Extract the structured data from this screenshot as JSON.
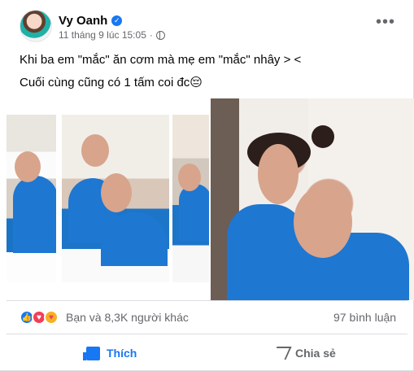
{
  "post": {
    "author": "Vy Oanh",
    "timestamp": "11 tháng 9 lúc 15:05",
    "visibility_icon": "globe-icon",
    "menu_icon": "more-options-icon",
    "text_line_1": "Khi ba em \"mắc\" ăn cơm mà mẹ em \"mắc\" nhây > <",
    "text_line_2": "Cuối cùng cũng có 1 tấm coi đc😔"
  },
  "stats": {
    "reaction_icons": [
      "like-icon",
      "love-icon",
      "care-icon"
    ],
    "reaction_summary": "Bạn và 8,3K người khác",
    "comments": "97 bình luận"
  },
  "actions": {
    "like": "Thích",
    "share": "Chia sẻ"
  },
  "colors": {
    "facebook_blue": "#1877f2",
    "secondary_text": "#65676b",
    "divider": "#dadde1"
  }
}
